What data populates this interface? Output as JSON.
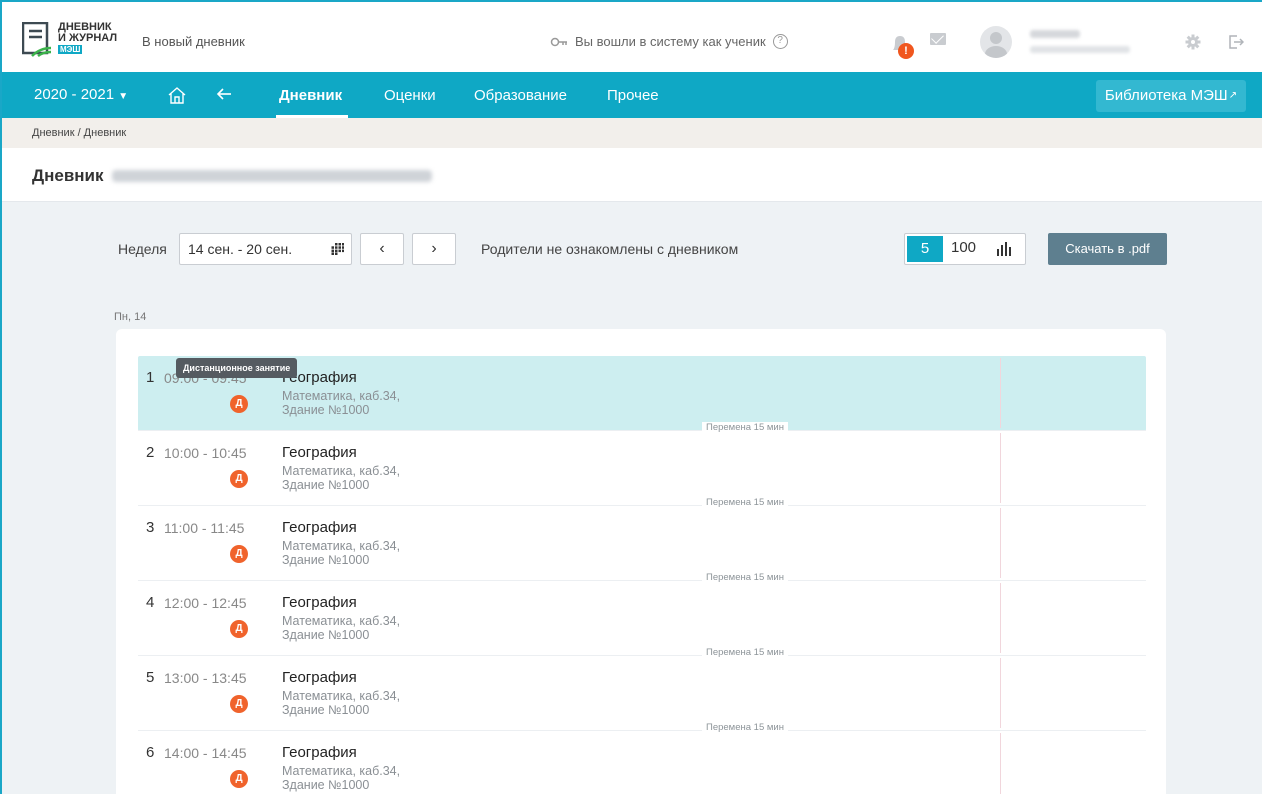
{
  "header": {
    "logo_line1": "ДНЕВНИК",
    "logo_line2": "И ЖУРНАЛ",
    "logo_badge": "МЭШ",
    "new_diary_link": "В новый дневник",
    "login_info": "Вы вошли в систему как ученик",
    "help_icon": "?",
    "notification_badge": "!",
    "icons": [
      "key-icon",
      "help-icon",
      "bell-icon",
      "mail-icon",
      "avatar",
      "gear-icon",
      "logout-icon"
    ]
  },
  "nav": {
    "year": "2020 - 2021",
    "items": [
      {
        "label": "Дневник",
        "active": true
      },
      {
        "label": "Оценки",
        "active": false
      },
      {
        "label": "Образование",
        "active": false
      },
      {
        "label": "Прочее",
        "active": false
      }
    ],
    "library_button": "Библиотека МЭШ",
    "accent_color": "#0fa8c5"
  },
  "breadcrumb": "Дневник / Дневник",
  "page": {
    "title": "Дневник"
  },
  "controls": {
    "week_label": "Неделя",
    "week_value": "14 сен. - 20 сен.",
    "prev_icon": "‹",
    "next_icon": "›",
    "parents_status": "Родители не ознакомлены с дневником",
    "scale_options": [
      "5",
      "100"
    ],
    "scale_selected": "5",
    "download_button": "Скачать в .pdf"
  },
  "day": {
    "label": "Пн, 14",
    "tooltip": "Дистанционное занятие",
    "break_label": "Перемена 15 мин",
    "lessons": [
      {
        "num": "1",
        "time": "09:00 - 09:45",
        "badge": "Д",
        "subject": "География",
        "room_line1": "Математика, каб.34,",
        "room_line2": "Здание №1000",
        "current": true
      },
      {
        "num": "2",
        "time": "10:00 - 10:45",
        "badge": "Д",
        "subject": "География",
        "room_line1": "Математика, каб.34,",
        "room_line2": "Здание №1000",
        "current": false
      },
      {
        "num": "3",
        "time": "11:00 - 11:45",
        "badge": "Д",
        "subject": "География",
        "room_line1": "Математика, каб.34,",
        "room_line2": "Здание №1000",
        "current": false
      },
      {
        "num": "4",
        "time": "12:00 - 12:45",
        "badge": "Д",
        "subject": "География",
        "room_line1": "Математика, каб.34,",
        "room_line2": "Здание №1000",
        "current": false
      },
      {
        "num": "5",
        "time": "13:00 - 13:45",
        "badge": "Д",
        "subject": "География",
        "room_line1": "Математика, каб.34,",
        "room_line2": "Здание №1000",
        "current": false
      },
      {
        "num": "6",
        "time": "14:00 - 14:45",
        "badge": "Д",
        "subject": "География",
        "room_line1": "Математика, каб.34,",
        "room_line2": "Здание №1000",
        "current": false
      }
    ]
  }
}
